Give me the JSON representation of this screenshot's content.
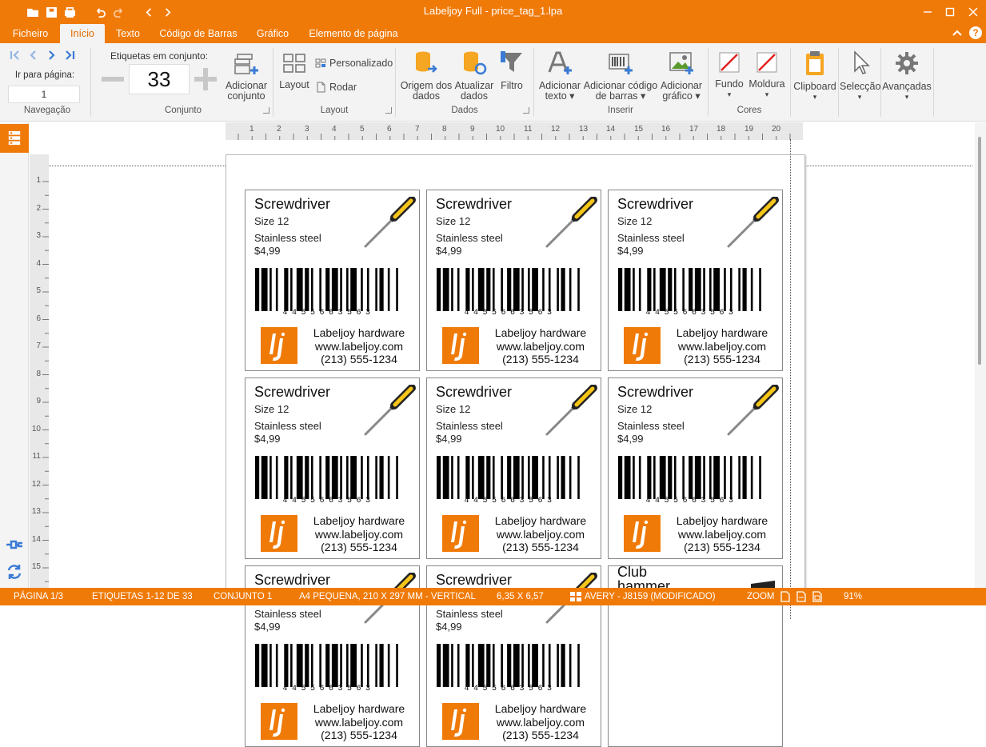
{
  "window": {
    "title": "Labeljoy Full - price_tag_1.lpa"
  },
  "tabs": [
    "Ficheiro",
    "Início",
    "Texto",
    "Código de Barras",
    "Gráfico",
    "Elemento de página"
  ],
  "ribbon": {
    "nav": {
      "page_label": "Ir para página:",
      "page_value": "1",
      "group": "Navegação"
    },
    "set": {
      "header": "Etiquetas em conjunto:",
      "count": "33",
      "add_l1": "Adicionar",
      "add_l2": "conjunto",
      "group": "Conjunto"
    },
    "layout": {
      "layout": "Layout",
      "custom": "Personalizado",
      "rotate": "Rodar",
      "group": "Layout"
    },
    "data": {
      "source_l1": "Origem dos",
      "source_l2": "dados",
      "update_l1": "Atualizar",
      "update_l2": "dados",
      "filter": "Filtro",
      "group": "Dados"
    },
    "insert": {
      "text_l1": "Adicionar",
      "text_l2": "texto",
      "bc_l1": "Adicionar código",
      "bc_l2": "de barras",
      "gr_l1": "Adicionar",
      "gr_l2": "gráfico",
      "group": "Inserir"
    },
    "colors": {
      "bg": "Fundo",
      "frame": "Moldura",
      "group": "Cores"
    },
    "clipboard": "Clipboard",
    "selection": "Selecção",
    "advanced": "Avançadas"
  },
  "ruler": {
    "h": [
      "1",
      "2",
      "3",
      "4",
      "5",
      "6",
      "7",
      "8",
      "9",
      "10",
      "11",
      "12",
      "13",
      "14",
      "15",
      "16",
      "17",
      "18",
      "19",
      "20"
    ],
    "v": [
      "1",
      "2",
      "3",
      "4",
      "5",
      "6",
      "7",
      "8",
      "9",
      "10",
      "11",
      "12",
      "13",
      "14",
      "15"
    ]
  },
  "label": {
    "title": "Screwdriver",
    "size": "Size 12",
    "material": "Stainless steel",
    "price": "$4,99",
    "barcode": "4455663563",
    "company": "Labeljoy hardware",
    "web": "www.labeljoy.com",
    "phone": "(213) 555-1234"
  },
  "partial_label": {
    "title_l1": "Club",
    "title_l2": "hammer"
  },
  "status": {
    "page": "PÁGINA 1/3",
    "labels": "ETIQUETAS 1-12 DE 33",
    "set": "CONJUNTO 1",
    "paper": "A4 PEQUENA, 210 X 297 MM - VERTICAL",
    "size": "6,35 X 6,57",
    "template": "AVERY - J8159 (MODIFICADO)",
    "zoom_label": "ZOOM",
    "zoom": "91%"
  },
  "colors": {
    "accent": "#f07a08",
    "nav_blue": "#3a7bd5"
  }
}
